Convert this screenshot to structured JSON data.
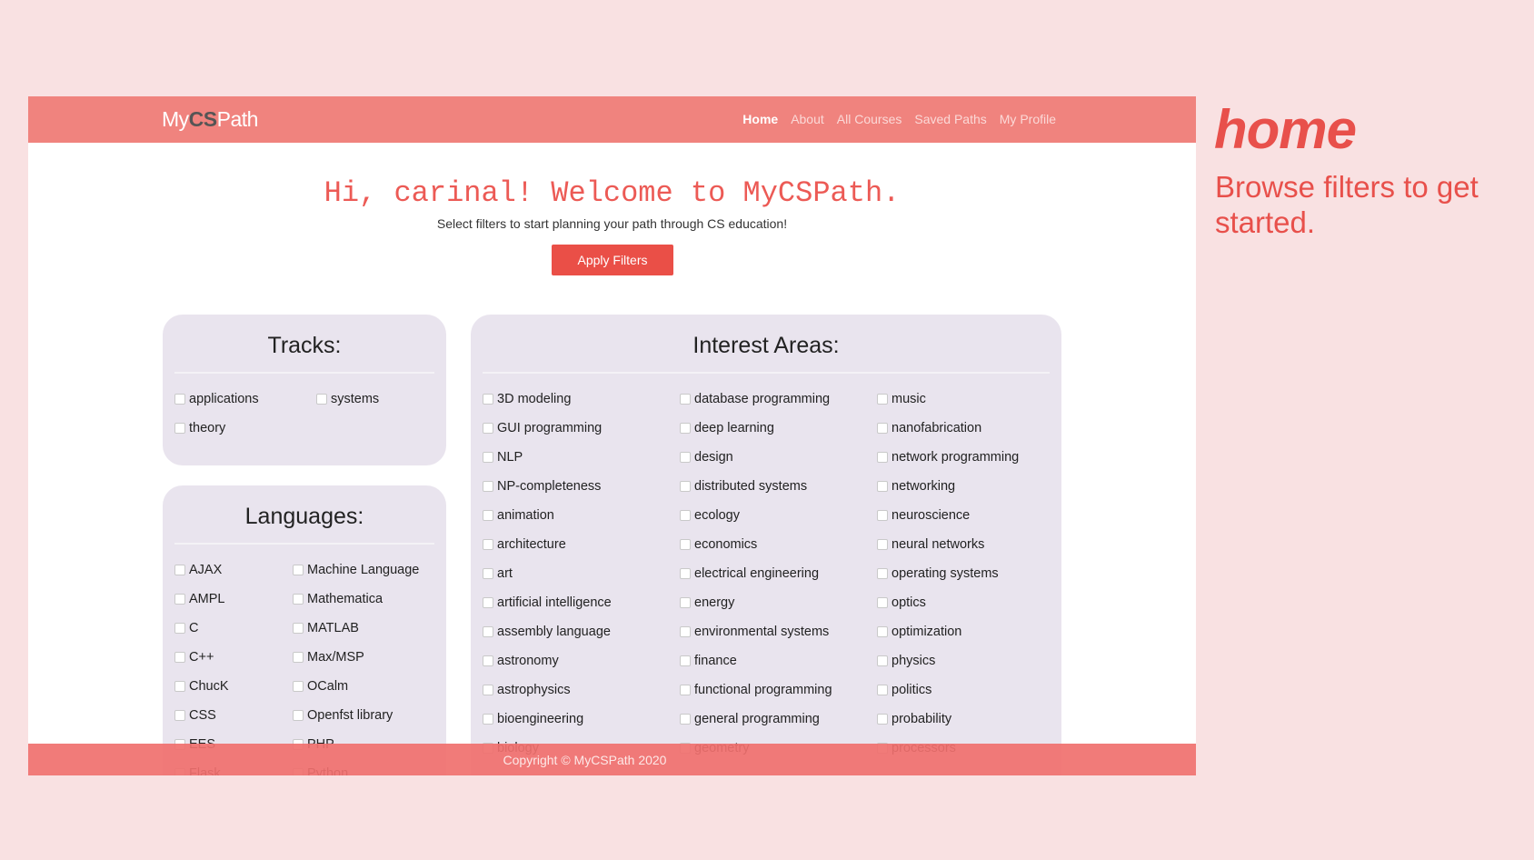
{
  "app": {
    "logo_prefix": "My",
    "logo_cs": "CS",
    "logo_suffix": "Path"
  },
  "nav": [
    "Home",
    "About",
    "All Courses",
    "Saved Paths",
    "My Profile"
  ],
  "hero": {
    "title": "Hi, carinal! Welcome to MyCSPath.",
    "subtitle": "Select filters to start planning your path through CS education!",
    "apply_label": "Apply Filters"
  },
  "tracks": {
    "title": "Tracks:",
    "items": [
      "applications",
      "systems",
      "theory"
    ]
  },
  "languages": {
    "title": "Languages:",
    "items": [
      "AJAX",
      "Machine Language",
      "AMPL",
      "Mathematica",
      "C",
      "MATLAB",
      "C++",
      "Max/MSP",
      "ChucK",
      "OCalm",
      "CSS",
      "Openfst library",
      "EES",
      "PHP",
      "Flask",
      "Python"
    ]
  },
  "interests": {
    "title": "Interest Areas:",
    "items": [
      "3D modeling",
      "database programming",
      "music",
      "GUI programming",
      "deep learning",
      "nanofabrication",
      "NLP",
      "design",
      "network programming",
      "NP-completeness",
      "distributed systems",
      "networking",
      "animation",
      "ecology",
      "neuroscience",
      "architecture",
      "economics",
      "neural networks",
      "art",
      "electrical engineering",
      "operating systems",
      "artificial intelligence",
      "energy",
      "optics",
      "assembly language",
      "environmental systems",
      "optimization",
      "astronomy",
      "finance",
      "physics",
      "astrophysics",
      "functional programming",
      "politics",
      "bioengineering",
      "general programming",
      "probability",
      "biology",
      "geometry",
      "processors"
    ]
  },
  "footer": "Copyright © MyCSPath 2020",
  "side": {
    "title": "home",
    "description": "Browse filters to get started."
  }
}
